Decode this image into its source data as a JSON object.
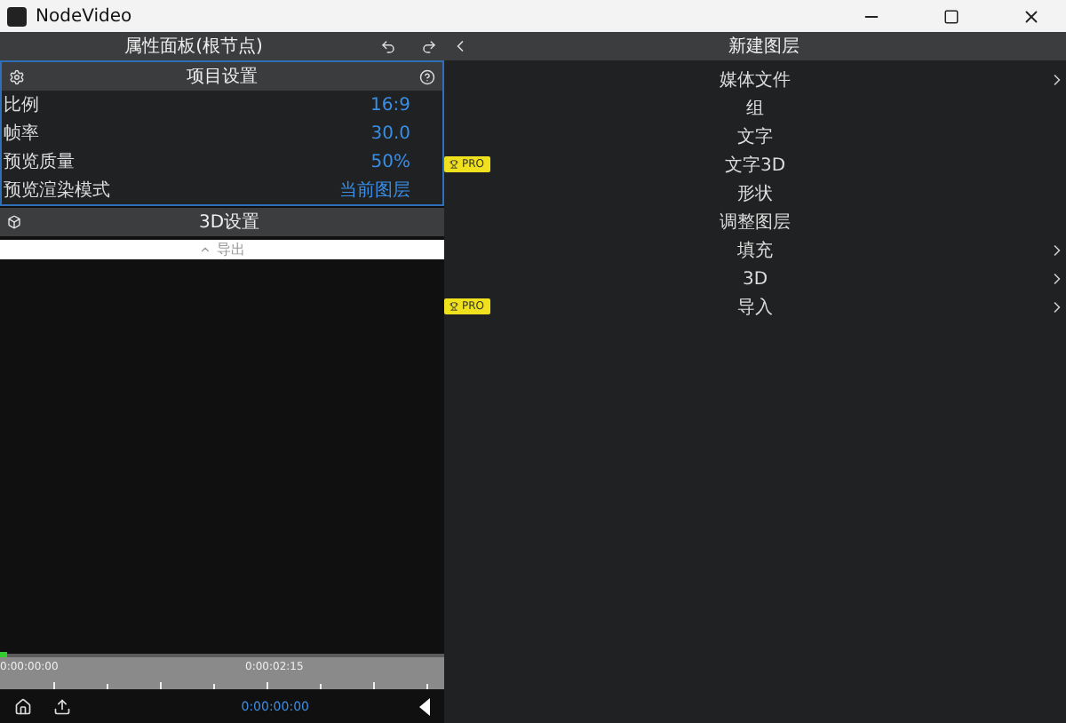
{
  "window": {
    "title": "NodeVideo"
  },
  "properties_panel": {
    "title": "属性面板(根节点)",
    "project_settings": {
      "title": "项目设置",
      "rows": [
        {
          "label": "比例",
          "value": "16:9"
        },
        {
          "label": "帧率",
          "value": "30.0"
        },
        {
          "label": "预览质量",
          "value": "50%"
        },
        {
          "label": "预览渲染模式",
          "value": "当前图层"
        }
      ]
    },
    "section_3d": "3D设置",
    "export": "导出"
  },
  "timeline": {
    "start": "0:00:00:00",
    "mark": "0:00:02:15",
    "current_time": "0:00:00:00"
  },
  "new_layer_panel": {
    "title": "新建图层",
    "items": [
      {
        "label": "媒体文件",
        "submenu": true
      },
      {
        "label": "组",
        "submenu": false
      },
      {
        "label": "文字",
        "submenu": false
      },
      {
        "label": "文字3D",
        "badge": "PRO",
        "submenu": false
      },
      {
        "label": "形状",
        "submenu": false
      },
      {
        "label": "调整图层",
        "submenu": false
      },
      {
        "label": "填充",
        "submenu": true
      },
      {
        "label": "3D",
        "submenu": true
      },
      {
        "label": "导入",
        "badge": "PRO",
        "submenu": true
      }
    ]
  }
}
